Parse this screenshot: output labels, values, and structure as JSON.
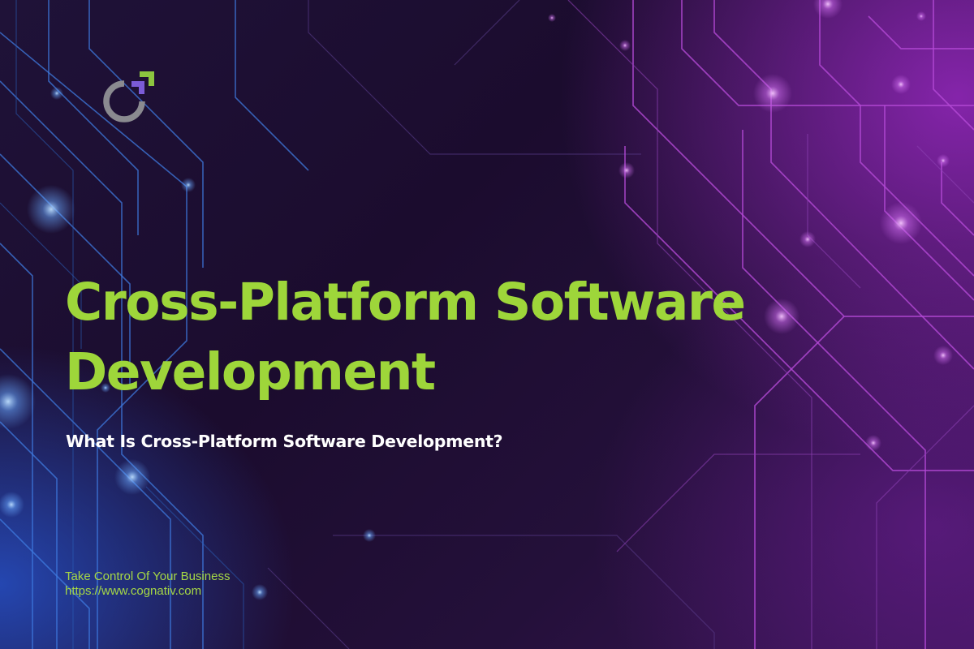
{
  "logo": {
    "icon": "cognativ-logo-icon",
    "ring_color": "#8a8a90",
    "corner_color_green": "#8cc63f",
    "corner_color_purple": "#7b5bd6"
  },
  "headline": {
    "line1": "Cross-Platform Software",
    "line2": "Development"
  },
  "subheading": "What Is Cross-Platform Software Development?",
  "footer": {
    "tagline": "Take Control Of Your Business",
    "url": "https://www.cognativ.com"
  },
  "colors": {
    "headline": "#9ed63a",
    "subheading": "#ffffff",
    "footer": "#a6d845",
    "circuit_blue": "#3f7be0",
    "circuit_purple": "#b44ad6",
    "background": "#1b0c2e"
  }
}
